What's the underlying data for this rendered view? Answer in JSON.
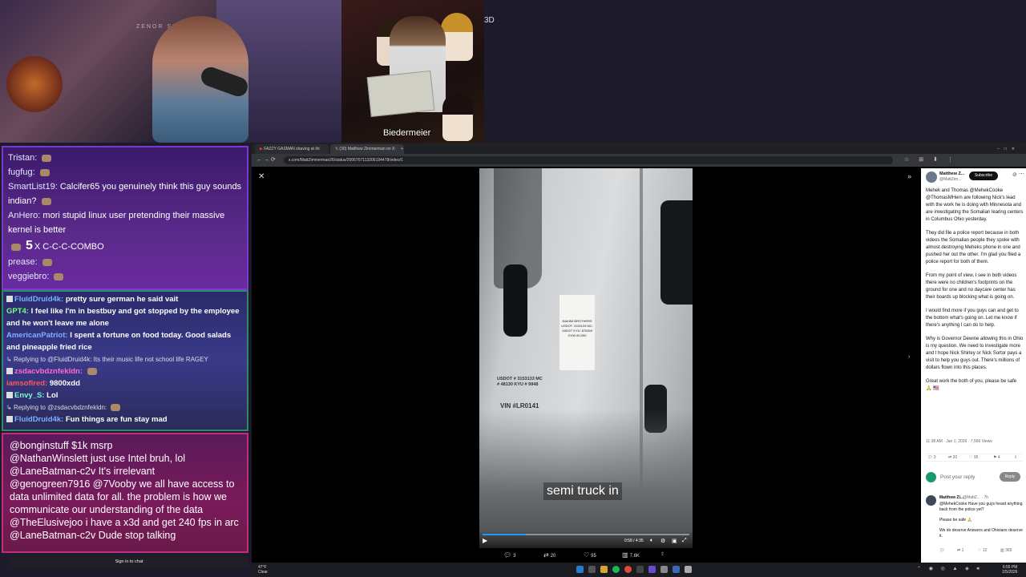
{
  "overlay": {
    "label_3d": "3D",
    "meme_caption": "Biedermeier",
    "webcam_sign": "ZENOR SUBSC"
  },
  "chat_top": {
    "messages": [
      {
        "user": "Tristan:",
        "text": ""
      },
      {
        "user": "fugfug:",
        "text": ""
      },
      {
        "user": "SmartList19:",
        "text": "Calcifer65 you genuinely think this guy sounds indian?"
      },
      {
        "user": "AnHero:",
        "text": "mori stupid linux user pretending their massive kernel is better"
      },
      {
        "user": "prease:",
        "text": ""
      },
      {
        "user": "veggiebro:",
        "text": ""
      }
    ],
    "combo_count": "5",
    "combo_text": "X C-C-C-COMBO"
  },
  "chat_mid": {
    "messages": [
      {
        "user": "FluidDruid4k:",
        "text": "pretty sure german he said vait",
        "color": "#7fb0ff"
      },
      {
        "user": "GPT4:",
        "text": "I feel like I'm in bestbuy and got stopped by the employee and he won't leave me alone",
        "color": "#7aff7a"
      },
      {
        "user": "AmericanPatriot:",
        "text": "I spent a fortune on food today. Good salads and pineapple fried rice",
        "color": "#7fb0ff"
      },
      {
        "reply": "Replying to @FluidDruid4k: Its their music life not school life RAGEY"
      },
      {
        "user": "zsdacvbdznfekldn:",
        "text": "",
        "color": "#ff6ad0"
      },
      {
        "user": "iamsofired:",
        "text": "9800xdd",
        "color": "#ff5a5a"
      },
      {
        "user": "Envy_S:",
        "text": "Lol",
        "color": "#7affd0"
      },
      {
        "reply": "Replying to @zsdacvbdznfekldn:"
      },
      {
        "user": "FluidDruid4k:",
        "text": "Fun things are fun stay mad",
        "color": "#7fb0ff"
      }
    ]
  },
  "chat_bottom": {
    "messages": [
      {
        "user": "@bonginstuff",
        "text": "$1k msrp"
      },
      {
        "user": "@NathanWinslett",
        "text": "just use Intel bruh, lol"
      },
      {
        "user": "@LaneBatman-c2v",
        "text": "It's irrelevant"
      },
      {
        "user": "@genogreen7916",
        "text": "@7Vooby we all have access to data unlimited data for all. the problem is how we communicate our understanding of the data"
      },
      {
        "user": "@TheElusivejoo",
        "text": "i have a x3d and get 240 fps in arc"
      },
      {
        "user": "@LaneBatman-c2v",
        "text": "Dude stop talking"
      }
    ],
    "signin_label": "Sign in to chat"
  },
  "browser": {
    "tabs": [
      {
        "label": "FAZZY GASMAN shaving at thi"
      },
      {
        "label": "(30) Matthew Zimmerman on X:"
      }
    ],
    "url": "x.com/MattZimmerman26/status/2006767113206194478/video/1"
  },
  "video": {
    "subtitle": "semi truck in",
    "time": "0:58 / 4:35",
    "progress": 0.21,
    "decal_text": "NAKIMI BROTHERS USDOT: 3153133 MC: 106027 KYU: 878304 GVW 80,000",
    "plate_text": "USDOT # 3153133 MC # 48130 KYU # 9948",
    "vin_text": "VIN #LR0141"
  },
  "actions": {
    "replies": "3",
    "reposts": "20",
    "likes": "95",
    "views": "7.6K"
  },
  "tweet": {
    "name": "Matthew Z...",
    "handle": "@MattZim...",
    "subscribe_label": "Subscribe",
    "paragraphs": [
      "Mehek and Thomas @MehekCooke @ThomasMHern are following Nick's lead with the work he is doing with Minnesota and are investigating the Somalian learing centers in Columbus Ohio yesterday.",
      "They did file a police report because in both videos the Somalian people they spoke with almost destroying Meheks phone in one and pushed her out the other. I'm glad you filed a police report for both of them.",
      "From my point of view, I see in both videos there were no children's footprints on the ground for one and no daycare center has their boards up blocking what is going on.",
      "I would find more if you guys can and get to the bottom what's going on. Let me know if there's anything I can do to help.",
      "Why is Governor Dewine allowing this in Ohio is my question. We need to investigate more and I hope Nick Shirley or Nick Sortor pays a visit to help you guys out. There's millions of dollars flown into this places.",
      "Great work the both of you, please be safe 🙏 🇺🇸"
    ],
    "meta": "11:38 AM · Jan 1, 2026 · 7,566 Views",
    "stats": {
      "replies": "3",
      "reposts": "20",
      "likes": "95",
      "bookmarks": "4"
    },
    "reply_placeholder": "Post your reply",
    "reply_button": "Reply",
    "reply": {
      "name": "Matthew Zi...",
      "handle": "@MattZ... · 7h",
      "paragraphs": [
        "@MehekCooke Have you guys heard anything back from the police yet?",
        "Please be safe 🙏",
        "We do deserve Answers and Ohioians deserve it."
      ],
      "stats": {
        "reposts": "1",
        "likes": "12",
        "views": "365"
      }
    }
  },
  "taskbar": {
    "temp": "47°F",
    "weather": "Clear",
    "time": "6:55 PM",
    "date": "1/5/2026"
  },
  "colors": {
    "accent": "#1d9bf0",
    "chat_top_border": "#7a3ad0",
    "chat_mid_border": "#2a8a6a",
    "chat_bottom_border": "#c0307a"
  }
}
